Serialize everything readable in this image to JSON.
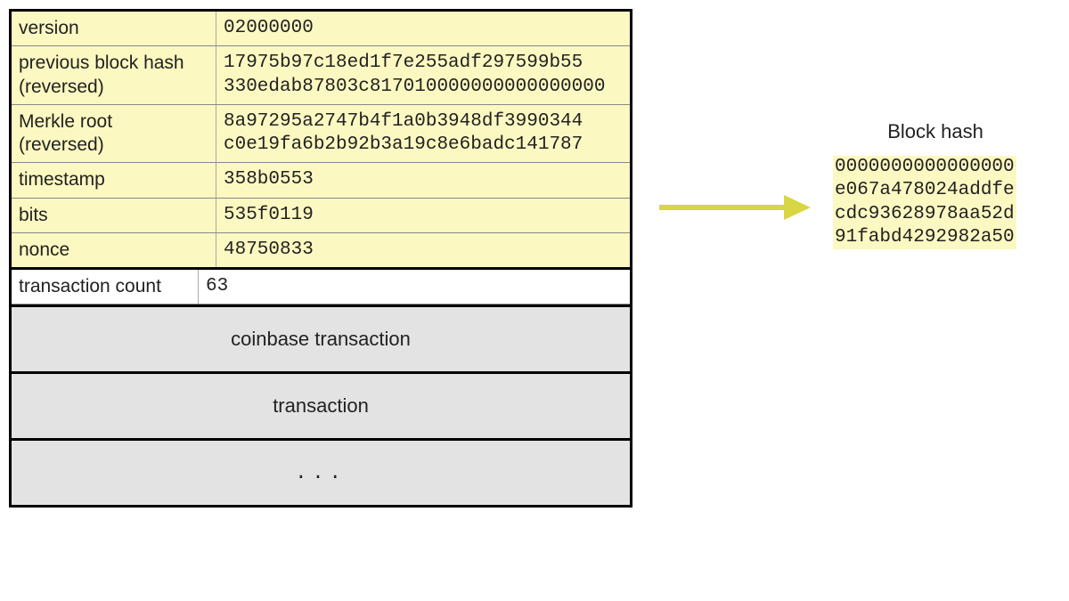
{
  "block": {
    "header": [
      {
        "label": "version",
        "value": "02000000"
      },
      {
        "label": "previous block hash\n(reversed)",
        "value": "17975b97c18ed1f7e255adf297599b55\n330edab87803c817010000000000000000"
      },
      {
        "label": "Merkle root\n(reversed)",
        "value": "8a97295a2747b4f1a0b3948df3990344\nc0e19fa6b2b92b3a19c8e6badc141787"
      },
      {
        "label": "timestamp",
        "value": "358b0553"
      },
      {
        "label": "bits",
        "value": "535f0119"
      },
      {
        "label": "nonce",
        "value": "48750833"
      }
    ],
    "tx_count_label": "transaction count",
    "tx_count_value": "63",
    "rows": [
      "coinbase transaction",
      "transaction",
      "..."
    ]
  },
  "hash": {
    "title": "Block hash",
    "value": "0000000000000000\ne067a478024addfe\ncdc93628978aa52d\n91fabd4292982a50"
  }
}
